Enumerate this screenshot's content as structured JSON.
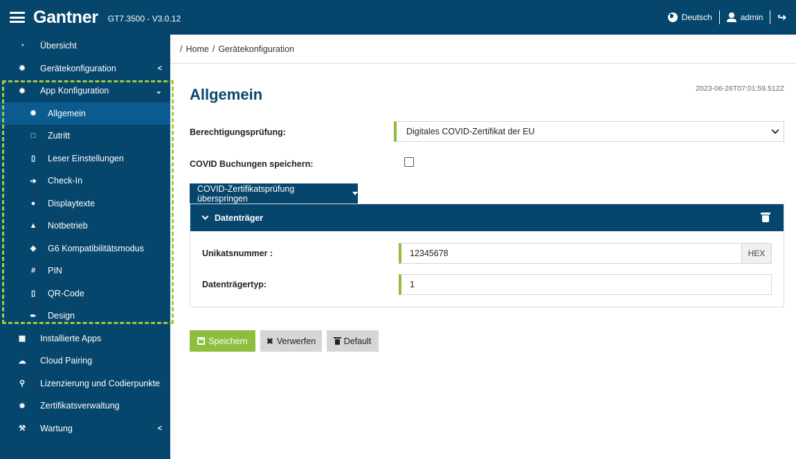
{
  "header": {
    "brand": "Gantner",
    "version": "GT7.3500 - V3.0.12",
    "language": "Deutsch",
    "user": "admin"
  },
  "sidebar": {
    "items": [
      {
        "label": "Übersicht",
        "icon": "pie-chart-icon"
      },
      {
        "label": "Gerätekonfiguration",
        "icon": "gear-icon"
      },
      {
        "label": "App Konfiguration",
        "icon": "gears-icon"
      },
      {
        "label": "Allgemein",
        "icon": "gear-icon"
      },
      {
        "label": "Zutritt",
        "icon": "unlock-icon"
      },
      {
        "label": "Leser Einstellungen",
        "icon": "reader-icon"
      },
      {
        "label": "Check-In",
        "icon": "sign-in-icon"
      },
      {
        "label": "Displaytexte",
        "icon": "globe-icon"
      },
      {
        "label": "Notbetrieb",
        "icon": "warning-icon"
      },
      {
        "label": "G6 Kompatibilitätsmodus",
        "icon": "cube-icon"
      },
      {
        "label": "PIN",
        "icon": "hash-icon"
      },
      {
        "label": "QR-Code",
        "icon": "qr-icon"
      },
      {
        "label": "Design",
        "icon": "brush-icon"
      },
      {
        "label": "Installierte Apps",
        "icon": "puzzle-icon"
      },
      {
        "label": "Cloud Pairing",
        "icon": "cloud-icon"
      },
      {
        "label": "Lizenzierung und Codierpunkte",
        "icon": "key-icon"
      },
      {
        "label": "Zertifikatsverwaltung",
        "icon": "certificate-icon"
      },
      {
        "label": "Wartung",
        "icon": "wrench-icon"
      }
    ]
  },
  "breadcrumb": {
    "sep": "/",
    "home": "Home",
    "current": "Gerätekonfiguration"
  },
  "main": {
    "title": "Allgemein",
    "timestamp": "2023-06-26T07:01:59.512Z",
    "check_label": "Berechtigungsprüfung:",
    "check_value": "Digitales COVID-Zertifikat der EU",
    "save_bookings_label": "COVID Buchungen speichern:",
    "skip_dropdown": "COVID-Zertifikatsprüfung überspringen",
    "panel": {
      "title": "Datenträger",
      "unique_label": "Unikatsnummer :",
      "unique_value": "12345678",
      "unique_addon": "HEX",
      "type_label": "Datenträgertyp:",
      "type_value": "1"
    },
    "buttons": {
      "save": "Speichern",
      "discard": "Verwerfen",
      "default": "Default"
    }
  }
}
